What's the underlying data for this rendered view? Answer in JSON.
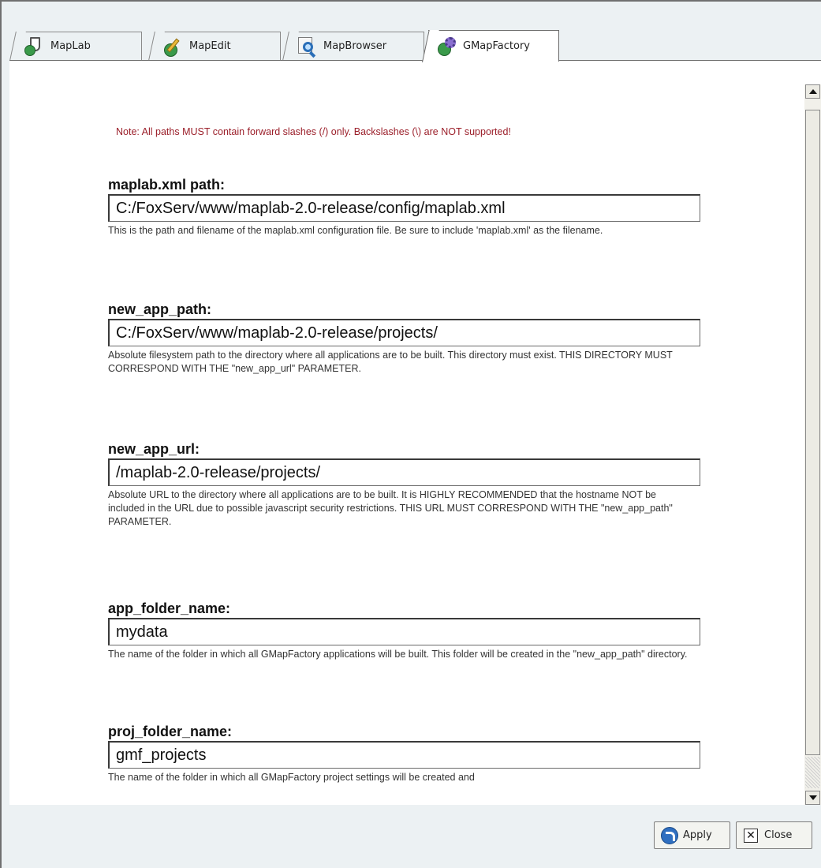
{
  "tabs": [
    {
      "label": "MapLab",
      "icon": "maplab-icon",
      "active": false
    },
    {
      "label": "MapEdit",
      "icon": "mapedit-icon",
      "active": false
    },
    {
      "label": "MapBrowser",
      "icon": "mapbrowser-icon",
      "active": false
    },
    {
      "label": "GMapFactory",
      "icon": "gmapfactory-icon",
      "active": true
    }
  ],
  "note": "Note: All paths MUST contain forward slashes (/) only. Backslashes (\\) are NOT supported!",
  "fields": [
    {
      "label": "maplab.xml path:",
      "value": "C:/FoxServ/www/maplab-2.0-release/config/maplab.xml",
      "description": "This is the path and filename of the maplab.xml configuration file. Be sure to include 'maplab.xml' as the filename."
    },
    {
      "label": "new_app_path:",
      "value": "C:/FoxServ/www/maplab-2.0-release/projects/",
      "description": "Absolute filesystem path to the directory where all applications are to be built. This directory must exist. THIS DIRECTORY MUST CORRESPOND WITH THE \"new_app_url\" PARAMETER."
    },
    {
      "label": "new_app_url:",
      "value": "/maplab-2.0-release/projects/",
      "description": "Absolute URL to the directory where all applications are to be built. It is HIGHLY RECOMMENDED that the hostname NOT be included in the URL due to possible javascript security restrictions. THIS URL MUST CORRESPOND WITH THE \"new_app_path\" PARAMETER."
    },
    {
      "label": "app_folder_name:",
      "value": "mydata",
      "description": "The name of the folder in which all GMapFactory applications will be built. This folder will be created in the \"new_app_path\" directory."
    },
    {
      "label": "proj_folder_name:",
      "value": "gmf_projects",
      "description": "The name of the folder in which all GMapFactory project settings will be created and"
    }
  ],
  "buttons": {
    "apply_label": "Apply",
    "close_label": "Close"
  },
  "colors": {
    "note_text": "#9b1f2a",
    "window_bg": "#ecf1f3",
    "panel_bg": "#ffffff"
  }
}
